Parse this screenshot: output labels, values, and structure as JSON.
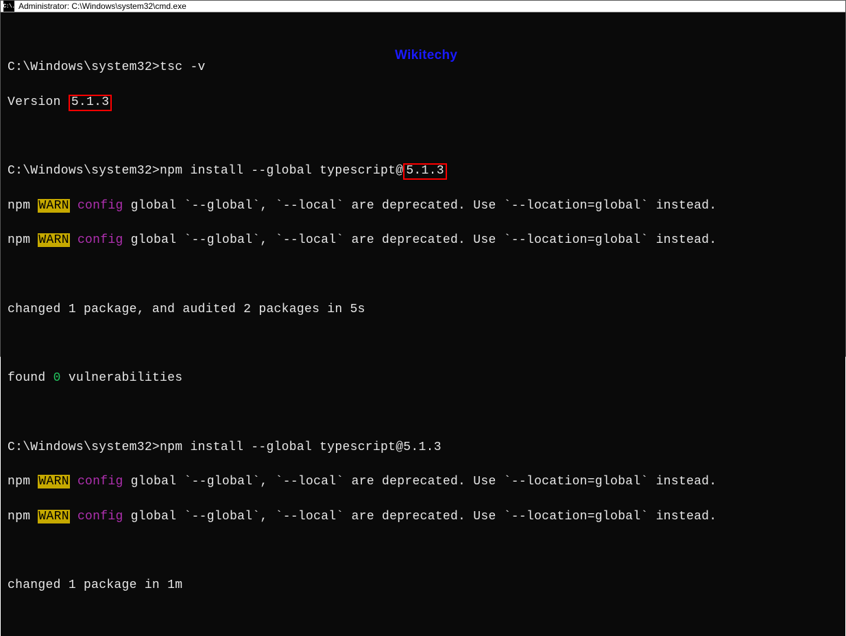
{
  "window": {
    "title": "Administrator:  C:\\Windows\\system32\\cmd.exe",
    "icon_text": "C:\\."
  },
  "terminal": {
    "prompt1": "C:\\Windows\\system32>",
    "cmd1": "tsc -v",
    "version_prefix": "Version ",
    "version_value": "5.1.3",
    "prompt2": "C:\\Windows\\system32>",
    "cmd2_pre": "npm install --global typescript@",
    "cmd2_ver": "5.1.3",
    "npm_word": "npm",
    "warn_word": "WARN",
    "config_word": "config",
    "deprecated_text": " global `--global`, `--local` are deprecated. Use `--location=global` instead.",
    "changed1": "changed 1 package, and audited 2 packages in 5s",
    "found_pre": "found ",
    "found_zero": "0",
    "found_post": " vulnerabilities",
    "prompt3": "C:\\Windows\\system32>",
    "cmd3": "npm install --global typescript@5.1.3",
    "changed2": "changed 1 package in 1m",
    "watermark": "Wikitechy"
  }
}
